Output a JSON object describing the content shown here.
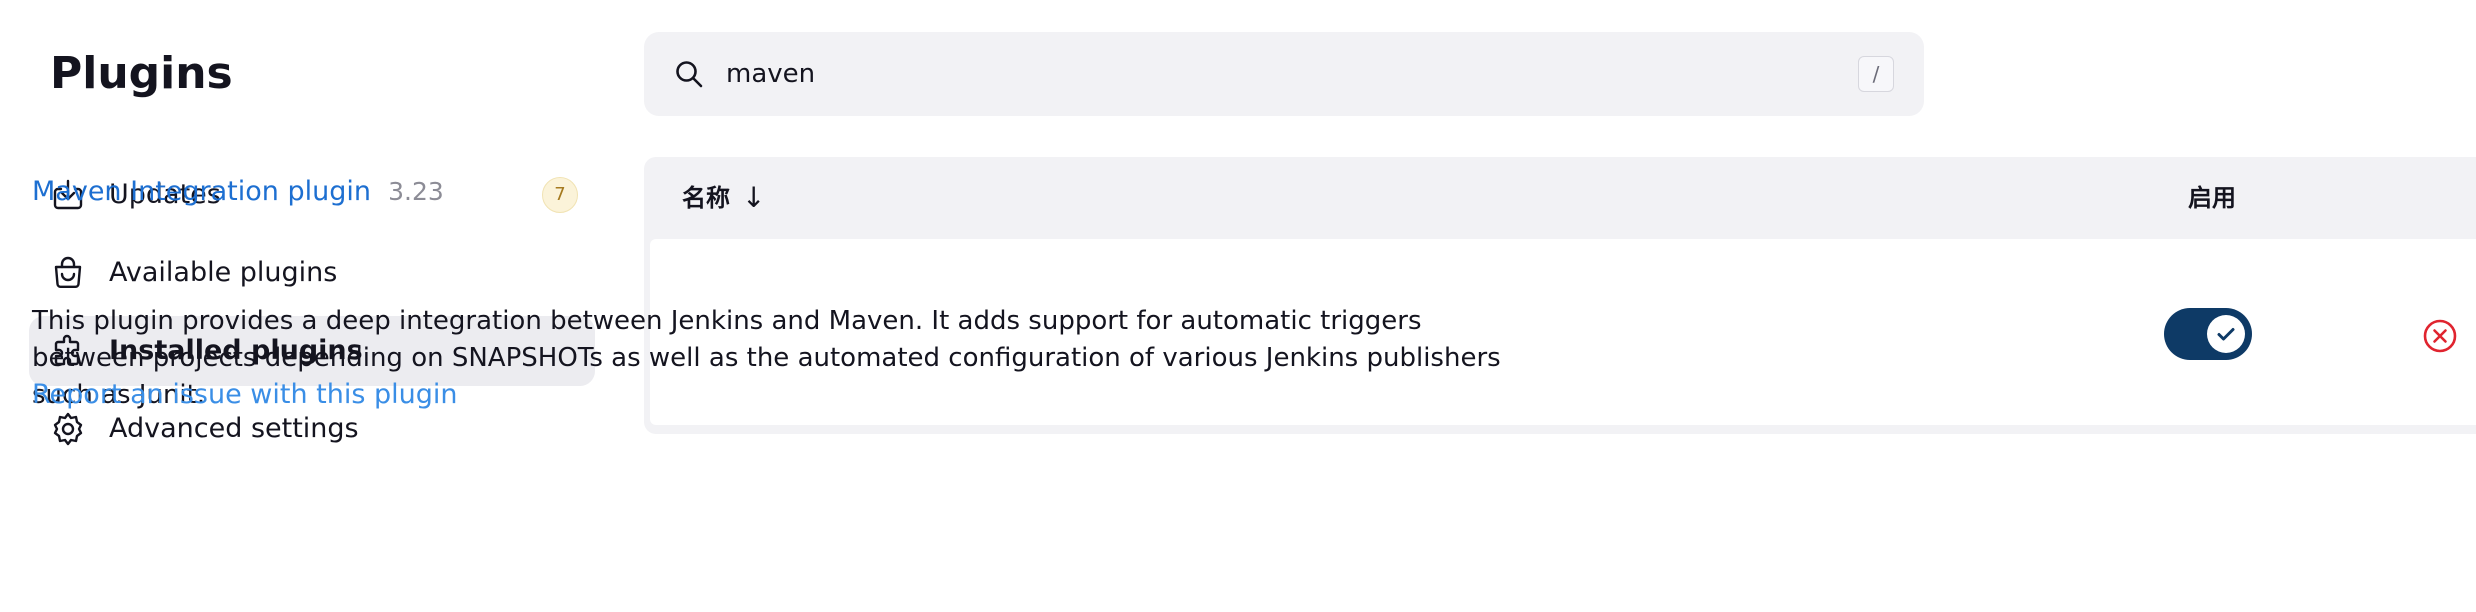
{
  "page": {
    "title": "Plugins"
  },
  "sidebar": {
    "items": [
      {
        "label": "Updates",
        "icon": "download-icon",
        "badge": "7"
      },
      {
        "label": "Available plugins",
        "icon": "shopping-bag-icon"
      },
      {
        "label": "Installed plugins",
        "icon": "puzzle-icon",
        "active": true
      },
      {
        "label": "Advanced settings",
        "icon": "gear-icon"
      }
    ]
  },
  "search": {
    "value": "maven",
    "shortcut": "/",
    "icon": "search-icon"
  },
  "table": {
    "columns": {
      "name": "名称",
      "enabled": "启用"
    },
    "sort_icon": "↓",
    "rows": [
      {
        "name": "Maven Integration plugin",
        "version": "3.23",
        "description": "This plugin provides a deep integration between Jenkins and Maven. It adds support for automatic triggers between projects depending on SNAPSHOTs as well as the automated configuration of various Jenkins publishers such as Junit.",
        "report_link": "Report an issue with this plugin",
        "enabled": true
      }
    ]
  },
  "colors": {
    "toggle_on": "#0e3a66",
    "link": "#1d6fd1",
    "remove": "#e0242f",
    "badge_bg": "#fbf3d9"
  }
}
